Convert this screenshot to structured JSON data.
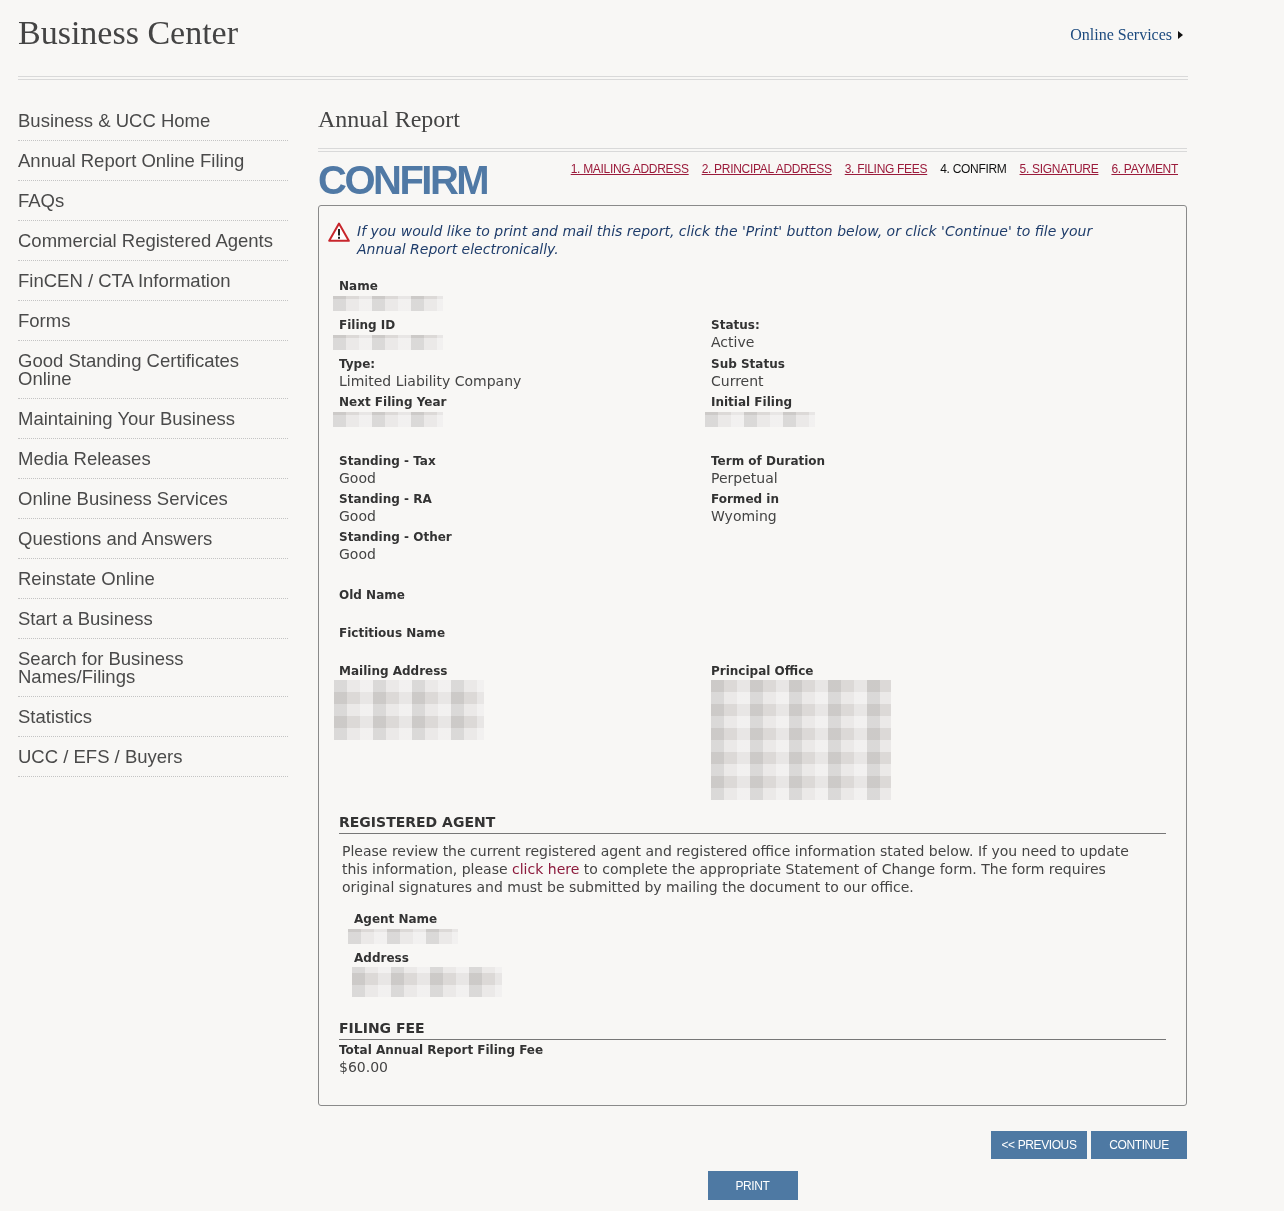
{
  "header": {
    "title": "Business Center",
    "link": "Online Services"
  },
  "sidebar": {
    "items": [
      "Business & UCC Home",
      "Annual Report Online Filing",
      "FAQs",
      "Commercial Registered Agents",
      "FinCEN / CTA Information",
      "Forms",
      "Good Standing Certificates Online",
      "Maintaining Your Business",
      "Media Releases",
      "Online Business Services",
      "Questions and Answers",
      "Reinstate Online",
      "Start a Business",
      "Search for Business Names/Filings",
      "Statistics",
      "UCC / EFS / Buyers"
    ]
  },
  "page": {
    "title": "Annual Report",
    "step_title": "CONFIRM"
  },
  "steps": [
    {
      "label": "1. MAILING ADDRESS",
      "selected": false
    },
    {
      "label": "2. PRINCIPAL ADDRESS",
      "selected": false
    },
    {
      "label": "3. FILING FEES",
      "selected": false
    },
    {
      "label": "4. CONFIRM",
      "selected": true
    },
    {
      "label": "5. SIGNATURE",
      "selected": false
    },
    {
      "label": "6. PAYMENT",
      "selected": false
    }
  ],
  "notice": {
    "text": "If you would like to print and mail this report, click the 'Print' button below, or click 'Continue' to file your Annual Report electronically."
  },
  "details": [
    {
      "rows": [
        {
          "fields": [
            {
              "label": "Name",
              "kind": "redacted_line"
            }
          ]
        },
        {
          "fields": [
            {
              "label": "Filing ID",
              "kind": "redacted_line"
            },
            {
              "label": "Status:",
              "kind": "text",
              "value": "Active"
            }
          ]
        },
        {
          "fields": [
            {
              "label": "Type:",
              "kind": "text",
              "value": "Limited Liability Company"
            },
            {
              "label": "Sub Status",
              "kind": "text",
              "value": "Current"
            }
          ]
        },
        {
          "fields": [
            {
              "label": "Next Filing Year",
              "kind": "redacted_line"
            },
            {
              "label": "Initial Filing",
              "kind": "redacted_line"
            }
          ]
        }
      ]
    },
    {
      "rows": [
        {
          "fields": [
            {
              "label": "Standing - Tax",
              "kind": "text",
              "value": "Good"
            },
            {
              "label": "Term of Duration",
              "kind": "text",
              "value": "Perpetual"
            }
          ]
        },
        {
          "fields": [
            {
              "label": "Standing - RA",
              "kind": "text",
              "value": "Good"
            },
            {
              "label": "Formed in",
              "kind": "text",
              "value": "Wyoming"
            }
          ]
        },
        {
          "fields": [
            {
              "label": "Standing - Other",
              "kind": "text",
              "value": "Good"
            }
          ]
        }
      ]
    },
    {
      "rows": [
        {
          "fields": [
            {
              "label": "Old Name",
              "kind": "empty"
            }
          ]
        },
        {
          "fields": [
            {
              "label": "Fictitious Name",
              "kind": "empty"
            }
          ]
        },
        {
          "fields": [
            {
              "label": "Mailing Address",
              "kind": "redacted_block"
            },
            {
              "label": "Principal Office",
              "kind": "redacted_tall"
            }
          ]
        }
      ]
    }
  ],
  "registered_agent": {
    "heading": "REGISTERED AGENT",
    "intro": {
      "before": "Please review the current registered agent and registered office information stated below. If you need to update this information, please",
      "link": "click here",
      "after": "to complete the appropriate Statement of Change form. The form requires original signatures and must be submitted by mailing the document to our office."
    },
    "fields": [
      {
        "label": "Agent Name",
        "kind": "redacted_line"
      },
      {
        "label": "Address",
        "kind": "redacted_pair"
      }
    ]
  },
  "filing_fee": {
    "heading": "FILING FEE",
    "label": "Total Annual Report Filing Fee",
    "value": "$60.00"
  },
  "buttons": [
    {
      "label": "<< PREVIOUS"
    },
    {
      "label": "CONTINUE"
    }
  ],
  "print_button": {
    "label": "PRINT"
  }
}
